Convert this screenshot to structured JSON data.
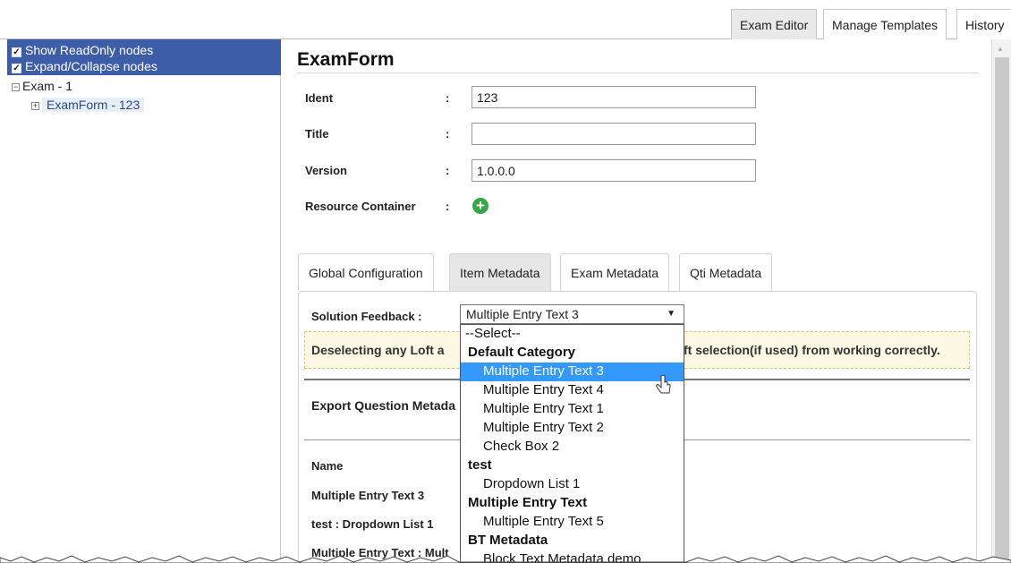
{
  "top_tabs": [
    "Exam Editor",
    "Manage Templates",
    "History"
  ],
  "tree_options": {
    "show_readonly": "Show ReadOnly nodes",
    "expand_collapse": "Expand/Collapse nodes"
  },
  "tree": {
    "root": "Exam - 1",
    "child": "ExamForm - 123",
    "toggle_expanded": "−",
    "toggle_collapsed": "+"
  },
  "form": {
    "title": "ExamForm",
    "colon": ":",
    "ident_label": "Ident",
    "ident_value": "123",
    "title_label": "Title",
    "title_value": "",
    "version_label": "Version",
    "version_value": "1.0.0.0",
    "resource_label": "Resource Container"
  },
  "tabs": [
    "Global Configuration",
    "Item Metadata",
    "Exam Metadata",
    "Qti Metadata"
  ],
  "solution_feedback": {
    "label": "Solution Feedback  :",
    "selected": "Multiple Entry Text 3"
  },
  "warning": {
    "left": "Deselecting any Loft a",
    "right": "ft selection(if used) from working correctly."
  },
  "export_label": "Export Question Metada",
  "table": {
    "header": "Name",
    "rows": [
      "Multiple Entry Text 3",
      "test : Dropdown List 1",
      "Multiple Entry Text : Mult"
    ]
  },
  "dropdown_items": [
    {
      "text": "--Select--",
      "kind": "plain"
    },
    {
      "text": "Default Category",
      "kind": "grp"
    },
    {
      "text": "Multiple Entry Text 3",
      "kind": "opt",
      "highlight": true
    },
    {
      "text": "Multiple Entry Text 4",
      "kind": "opt"
    },
    {
      "text": "Multiple Entry Text 1",
      "kind": "opt"
    },
    {
      "text": "Multiple Entry Text 2",
      "kind": "opt"
    },
    {
      "text": "Check Box 2",
      "kind": "opt"
    },
    {
      "text": "test",
      "kind": "grp"
    },
    {
      "text": "Dropdown List 1",
      "kind": "opt"
    },
    {
      "text": "Multiple Entry Text",
      "kind": "grp"
    },
    {
      "text": "Multiple Entry Text 5",
      "kind": "opt"
    },
    {
      "text": "BT Metadata",
      "kind": "grp"
    },
    {
      "text": "Block Text Metadata demo",
      "kind": "opt"
    }
  ],
  "colors": {
    "tree_header": "#3e5da8",
    "highlight": "#3399ff",
    "add_icon": "#35a745",
    "warning_bg": "#fcf8e3"
  },
  "icons": [
    "checkbox-icon",
    "tree-toggle-icon",
    "add-icon",
    "dropdown-arrow-icon",
    "mouse-cursor-icon"
  ]
}
